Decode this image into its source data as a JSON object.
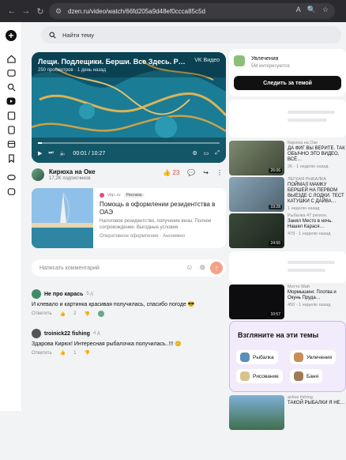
{
  "browser": {
    "url": "dzen.ru/video/watch/66fd205a9d48ef0ccca85c5d"
  },
  "search": {
    "placeholder": "Найти тему"
  },
  "video": {
    "title": "Лещи. Подлещики. Берши. Все Здесь. Р…",
    "meta": "250 просмотров · 1 день назад",
    "brand": "VK Видео",
    "time": "00:01 / 10:27",
    "progress": 0.02
  },
  "channel": {
    "name": "Кирюха на Оке",
    "subs": "17,2K подписчиков",
    "likes": "23"
  },
  "ad": {
    "source": "vtqc.ru",
    "tag": "Реклама",
    "title": "Помощь в оформлении резидентства в ОАЭ",
    "desc": "Налоговое резидентство, получение визы. Полное сопровождение. Выгодные условия",
    "foot": "Оперативное оформление · Анонимно"
  },
  "comment_input": {
    "placeholder": "Написать комментарий"
  },
  "comments": [
    {
      "name": "Не про карась",
      "time": "5 д",
      "text": "И клевало и картинка красивая получилась, спасибо погоде 😎",
      "reply": "Ответить",
      "likes": "2"
    },
    {
      "name": "troinick22 fishing",
      "time": "4 д",
      "text": "Здарова Кирюх! Интересная рыбалочка получилась..!!! 😊",
      "reply": "Ответить",
      "likes": "1"
    }
  ],
  "side": {
    "topic": {
      "name": "Увлечения",
      "count": "5М интересуются",
      "button": "Следить за темой"
    },
    "recs": [
      {
        "channel": "Кирюха на Оке",
        "title": "ДА ФИГ ВЫ ВЕРИТЕ. ТАК ОБЫЧНО ЭТО ВИДЕО, ВСЁ…",
        "meta": "2К · 1 неделю назад",
        "dur": "26:06"
      },
      {
        "channel": "ЛЕГКАЯ РЫБАЛКА",
        "title": "ПОЙМАЛ МАМКУ БЕРШЕЙ НА ПЕРВОМ ВЫЕЗДЕ С ЛОДКИ. ТЕСТ КАТУШКИ С ДАЙВА…",
        "meta": "1 неделю назад",
        "dur": "19:28"
      },
      {
        "channel": "Рыбалка 47 регион.",
        "title": "Занял Место в ночь. Нашел Карася…",
        "meta": "479 · 1 неделю назад",
        "dur": "24:55"
      },
      {
        "channel": "Мотто Май",
        "title": "Мормышинг. Плотва и Окунь Пруда…",
        "meta": "450 · 1 неделю назад",
        "dur": "10:57"
      }
    ],
    "themes": {
      "title": "Взгляните на эти темы",
      "chips": [
        "Рыбалка",
        "Увлечения",
        "Рисование",
        "Баня"
      ]
    },
    "bottom": {
      "channel": "active fishing",
      "title": "ТАКОЙ РЫБАЛКИ Я НЕ…"
    }
  }
}
